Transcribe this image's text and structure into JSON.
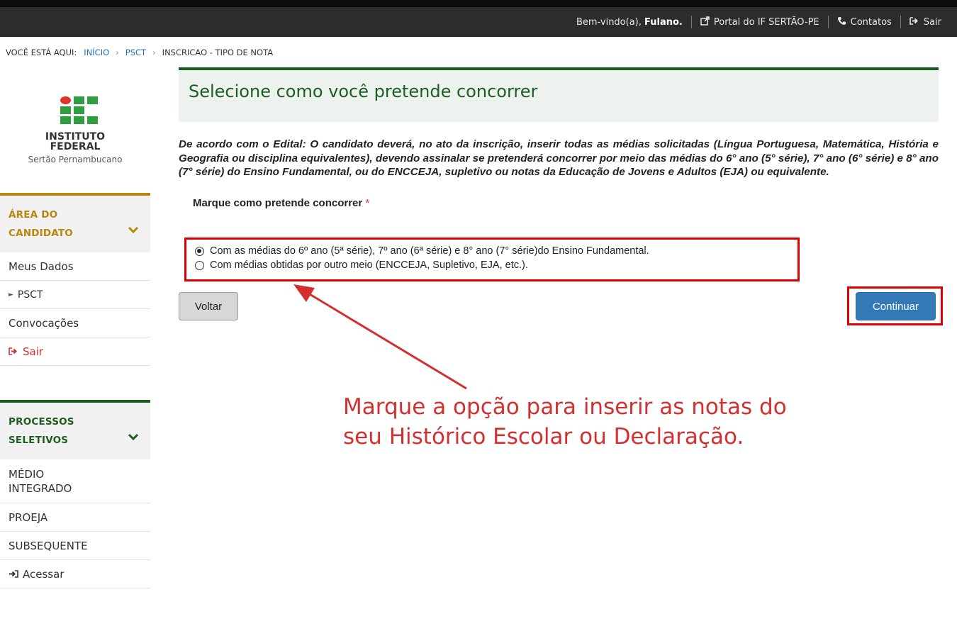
{
  "topbar": {
    "welcome_prefix": "Bem-vindo(a),",
    "welcome_name": "Fulano.",
    "portal_label": "Portal do IF SERTÃO-PE",
    "contatos_label": "Contatos",
    "sair_label": "Sair",
    "portal_icon": "external-link-icon",
    "contatos_icon": "phone-icon",
    "sair_icon": "sign-out-icon"
  },
  "breadcrumb": {
    "label": "VOCÊ ESTÁ AQUI:",
    "items": [
      "INÍCIO",
      "PSCT",
      "INSCRICAO - TIPO DE NOTA"
    ]
  },
  "logo": {
    "line1": "INSTITUTO",
    "line2": "FEDERAL",
    "subtitle": "Sertão Pernambucano"
  },
  "sidebar": {
    "candidate_panel": {
      "title_line1": "ÁREA DO",
      "title_line2": "CANDIDATO",
      "items": [
        "Meus Dados",
        "PSCT",
        "Convocações",
        "Sair"
      ]
    },
    "process_panel": {
      "title_line1": "PROCESSOS",
      "title_line2": "SELETIVOS",
      "items": [
        "MÉDIO INTEGRADO",
        "PROEJA",
        "SUBSEQUENTE",
        "Acessar"
      ]
    }
  },
  "main": {
    "title": "Selecione como você pretende concorrer",
    "edital_text": "De acordo com o Edital: O candidato deverá, no ato da inscrição, inserir todas as médias solicitadas (Língua Portuguesa, Matemática, História e Geografia ou disciplina equivalentes), devendo assinalar se pretenderá concorrer por meio das médias do 6° ano (5° série), 7° ano (6° série) e 8° ano (7° série) do Ensino Fundamental, ou do ENCCEJA, supletivo ou notas da Educação de Jovens e Adultos (EJA) ou equivalente.",
    "form_label": "Marque como pretende concorrer",
    "required_mark": "*",
    "options": [
      {
        "label": "Com as médias do 6º ano (5ª série), 7º ano (6ª série) e 8° ano (7° série)do Ensino Fundamental.",
        "selected": true
      },
      {
        "label": "Com médias obtidas por outro meio (ENCCEJA, Supletivo, EJA, etc.).",
        "selected": false
      }
    ],
    "back_button": "Voltar",
    "continue_button": "Continuar"
  },
  "annotation": {
    "line1": "Marque a opção para inserir as notas do",
    "line2": "seu Histórico Escolar ou Declaração."
  },
  "colors": {
    "green": "#1b5e20",
    "gold": "#b8860b",
    "highlight_red": "#dd0000",
    "button_blue": "#337ab7"
  }
}
